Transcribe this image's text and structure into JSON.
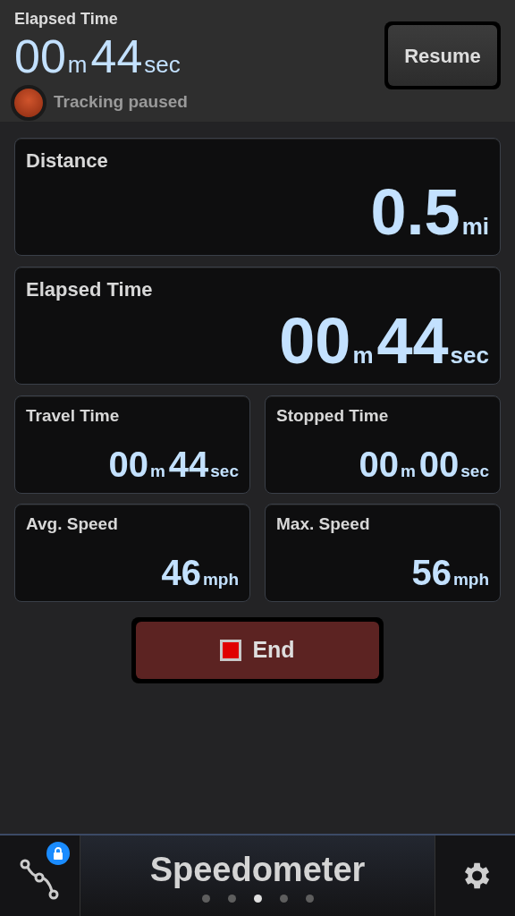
{
  "header": {
    "label": "Elapsed Time",
    "value": [
      {
        "text": "00",
        "kind": "number"
      },
      {
        "text": "m",
        "kind": "unit"
      },
      {
        "text": "44",
        "kind": "number"
      },
      {
        "text": "sec",
        "kind": "unit"
      }
    ],
    "status": "Tracking paused",
    "button": "Resume"
  },
  "large_cards": [
    {
      "label": "Distance",
      "value": [
        {
          "text": "0.5",
          "kind": "number"
        },
        {
          "text": "mi",
          "kind": "unit"
        }
      ]
    },
    {
      "label": "Elapsed Time",
      "value": [
        {
          "text": "00",
          "kind": "number"
        },
        {
          "text": "m",
          "kind": "unit"
        },
        {
          "text": "44",
          "kind": "number"
        },
        {
          "text": "sec",
          "kind": "unit"
        }
      ]
    }
  ],
  "small_cards": [
    {
      "label": "Travel Time",
      "value": [
        {
          "text": "00",
          "kind": "number"
        },
        {
          "text": "m",
          "kind": "unit"
        },
        {
          "text": "44",
          "kind": "number"
        },
        {
          "text": "sec",
          "kind": "unit"
        }
      ]
    },
    {
      "label": "Stopped Time",
      "value": [
        {
          "text": "00",
          "kind": "number"
        },
        {
          "text": "m",
          "kind": "unit"
        },
        {
          "text": "00",
          "kind": "number"
        },
        {
          "text": "sec",
          "kind": "unit"
        }
      ]
    },
    {
      "label": "Avg. Speed",
      "value": [
        {
          "text": "46",
          "kind": "number"
        },
        {
          "text": "mph",
          "kind": "unit"
        }
      ]
    },
    {
      "label": "Max. Speed",
      "value": [
        {
          "text": "56",
          "kind": "number"
        },
        {
          "text": "mph",
          "kind": "unit"
        }
      ]
    }
  ],
  "end_button": "End",
  "footer": {
    "title": "Speedometer",
    "pages": [
      {
        "selected": false
      },
      {
        "selected": false
      },
      {
        "selected": true
      },
      {
        "selected": false
      },
      {
        "selected": false
      }
    ]
  }
}
